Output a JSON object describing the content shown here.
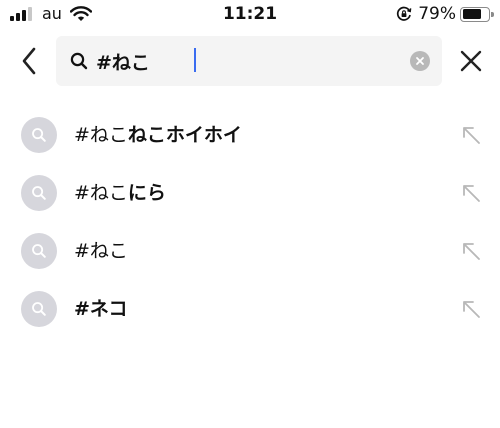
{
  "status_bar": {
    "carrier": "au",
    "time": "11:21",
    "battery_percent": "79%",
    "battery_level": 0.79,
    "signal_bars_filled": 3,
    "signal_bars_total": 4
  },
  "search": {
    "value": "#ねこ",
    "placeholder": "",
    "back_icon": "chevron-left-icon",
    "clear_icon": "clear-icon",
    "close_icon": "close-icon",
    "caret_color": "#3a6cf0"
  },
  "suggestions": [
    {
      "prefix": "#ねこ",
      "suffix": "ねこホイホイ"
    },
    {
      "prefix": "#ねこ",
      "suffix": "にら"
    },
    {
      "prefix": "#ねこ",
      "suffix": ""
    },
    {
      "prefix": "",
      "suffix": "#ネコ"
    }
  ],
  "colors": {
    "icon_circle": "#d6d6dc",
    "search_bg": "#f4f4f4",
    "arrow": "#b8b8b8"
  }
}
